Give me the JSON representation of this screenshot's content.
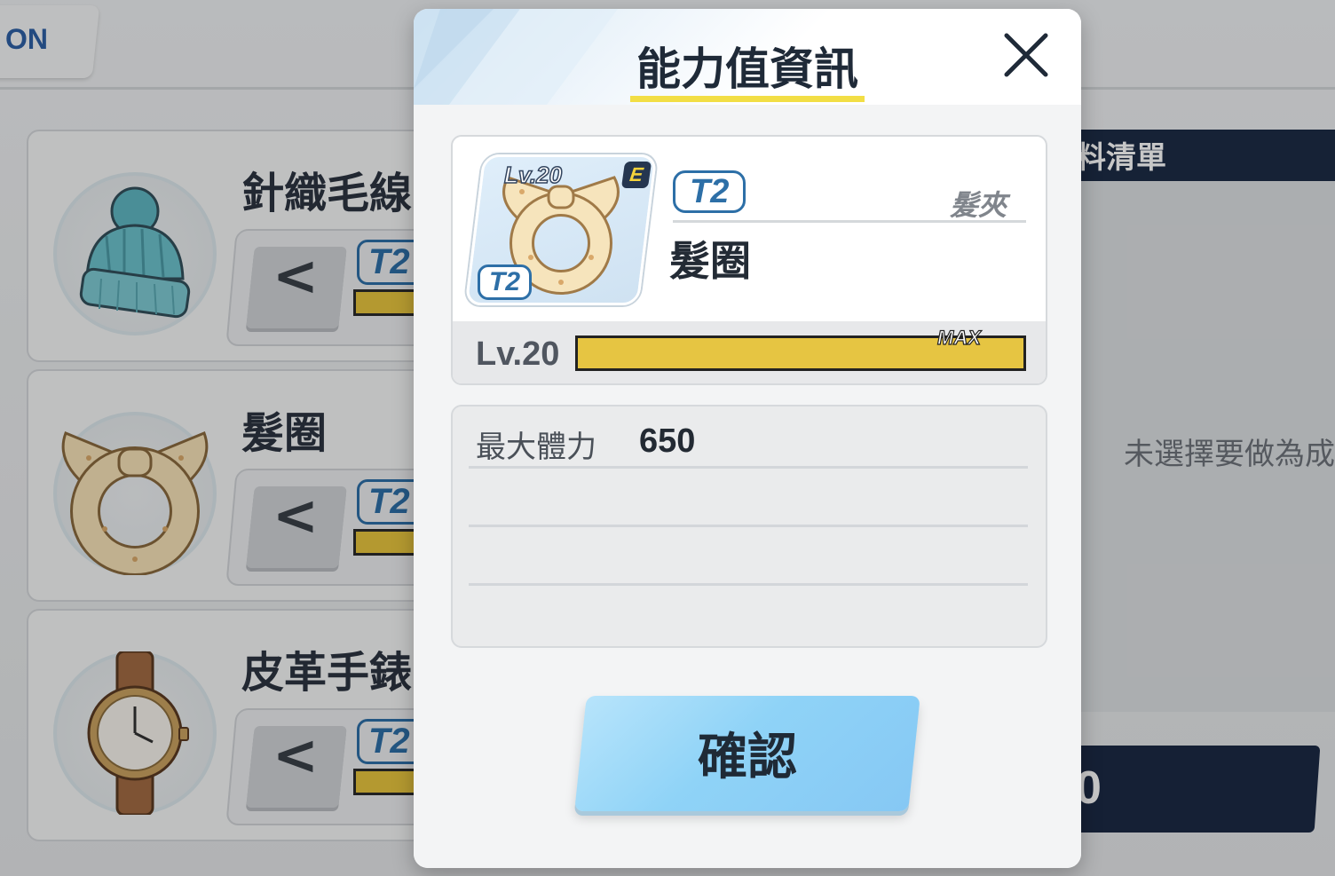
{
  "background": {
    "top_tab_label": "ON",
    "items": [
      {
        "name": "針織毛線",
        "tier": "T2",
        "icon": "knit-beanie-icon"
      },
      {
        "name": "髮圈",
        "tier": "T2",
        "icon": "scrunchie-icon"
      },
      {
        "name": "皮革手錶",
        "tier": "T2",
        "icon": "leather-watch-icon"
      }
    ],
    "arrow_label": "<",
    "right_panel": {
      "header": "料清單",
      "empty_text": "未選擇要做為成",
      "button_text": "0"
    }
  },
  "dialog": {
    "title": "能力值資訊",
    "close_icon": "close-icon",
    "equipment": {
      "icon": "scrunchie-icon",
      "icon_level": "Lv.20",
      "grade": "E",
      "icon_tier": "T2",
      "tier": "T2",
      "type": "髮夾",
      "name": "髮圈",
      "level_label": "Lv.20",
      "level_max": "MAX",
      "level_progress": 1.0
    },
    "stats": [
      {
        "label": "最大體力",
        "value": "650"
      },
      {
        "label": "",
        "value": ""
      },
      {
        "label": "",
        "value": ""
      }
    ],
    "confirm_label": "確認"
  },
  "colors": {
    "accent_blue": "#2d6fa7",
    "bar_yellow": "#e6c542",
    "title_underline": "#f2de45",
    "confirm_button": "#8fd3f7",
    "dark_navy": "#1d2c46"
  }
}
